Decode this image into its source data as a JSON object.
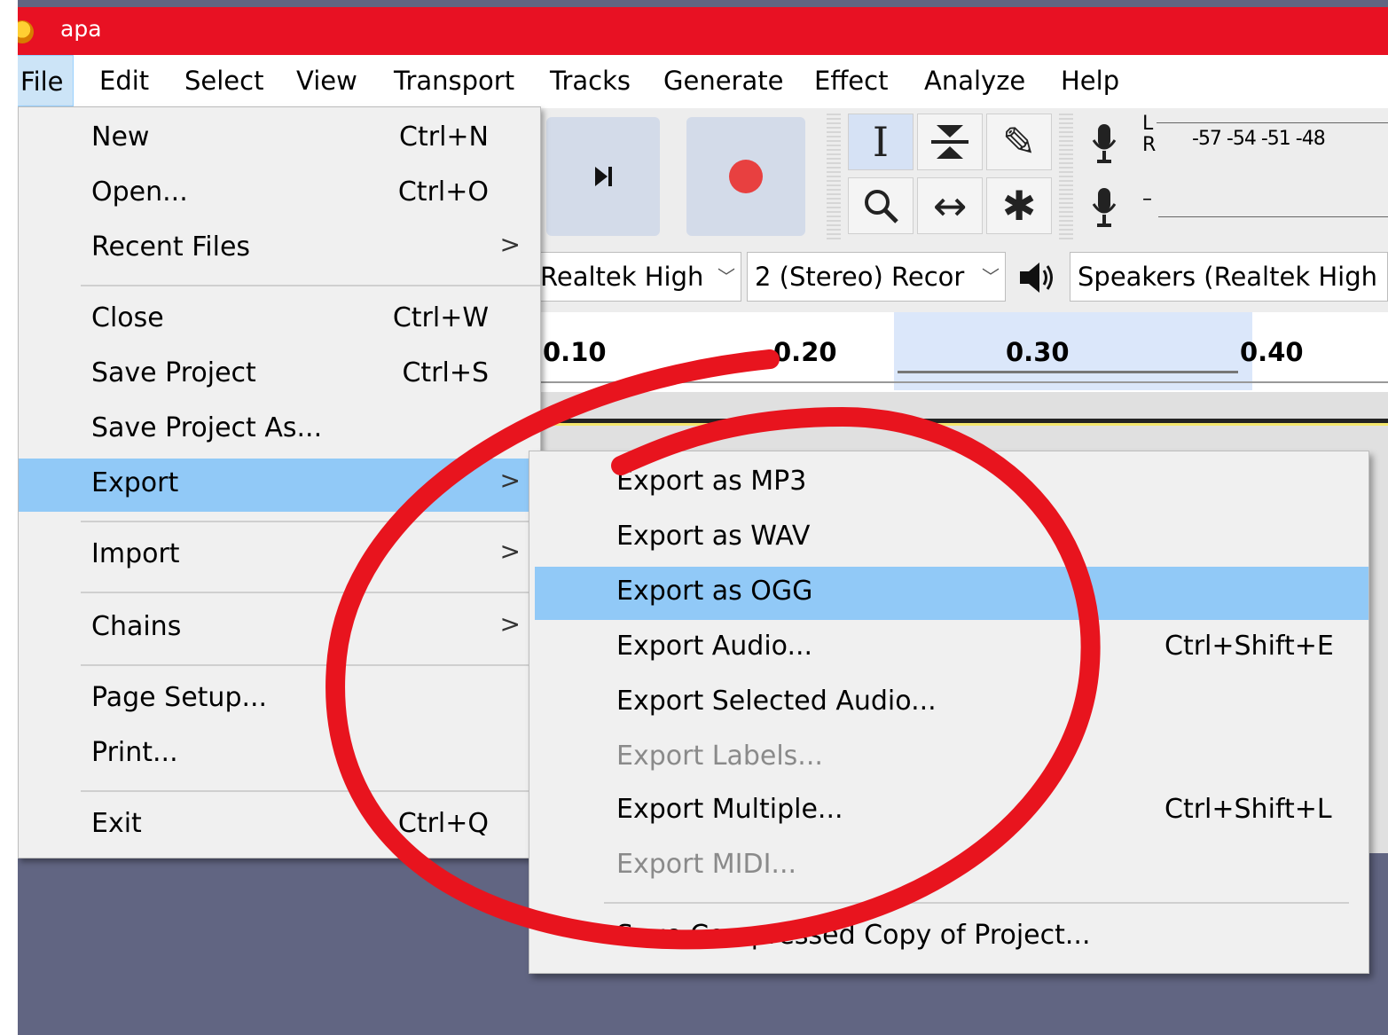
{
  "window": {
    "title": "apa"
  },
  "menubar": {
    "items": [
      {
        "label": "File"
      },
      {
        "label": "Edit"
      },
      {
        "label": "Select"
      },
      {
        "label": "View"
      },
      {
        "label": "Transport"
      },
      {
        "label": "Tracks"
      },
      {
        "label": "Generate"
      },
      {
        "label": "Effect"
      },
      {
        "label": "Analyze"
      },
      {
        "label": "Help"
      }
    ]
  },
  "toolbar": {
    "meter_l": "L",
    "meter_r": "R",
    "meter_scale": "-57 -54 -51 -48",
    "meter_minus": "–",
    "recording_device": "Realtek High",
    "recording_channels": "2 (Stereo) Recor",
    "playback_device": "Speakers (Realtek High D"
  },
  "ruler": {
    "ticks": [
      "0.10",
      "0.20",
      "0.30",
      "0.40"
    ]
  },
  "file_menu": {
    "items": [
      {
        "label": "New",
        "shortcut": "Ctrl+N"
      },
      {
        "label": "Open...",
        "shortcut": "Ctrl+O"
      },
      {
        "label": "Recent Files",
        "submenu": ">"
      },
      {
        "label": "Close",
        "shortcut": "Ctrl+W"
      },
      {
        "label": "Save Project",
        "shortcut": "Ctrl+S"
      },
      {
        "label": "Save Project As..."
      },
      {
        "label": "Export",
        "submenu": ">"
      },
      {
        "label": "Import",
        "submenu": ">"
      },
      {
        "label": "Chains",
        "submenu": ">"
      },
      {
        "label": "Page Setup..."
      },
      {
        "label": "Print..."
      },
      {
        "label": "Exit",
        "shortcut": "Ctrl+Q"
      }
    ]
  },
  "export_menu": {
    "items": [
      {
        "label": "Export as MP3"
      },
      {
        "label": "Export as WAV"
      },
      {
        "label": "Export as OGG"
      },
      {
        "label": "Export Audio...",
        "shortcut": "Ctrl+Shift+E"
      },
      {
        "label": "Export Selected Audio..."
      },
      {
        "label": "Export Labels..."
      },
      {
        "label": "Export Multiple...",
        "shortcut": "Ctrl+Shift+L"
      },
      {
        "label": "Export MIDI..."
      },
      {
        "label": "Save Compressed Copy of Project..."
      }
    ]
  },
  "colors": {
    "title_bar": "#e81123",
    "menu_highlight": "#91c9f7",
    "annotation_circle": "#e8141e",
    "background": "#616582"
  }
}
